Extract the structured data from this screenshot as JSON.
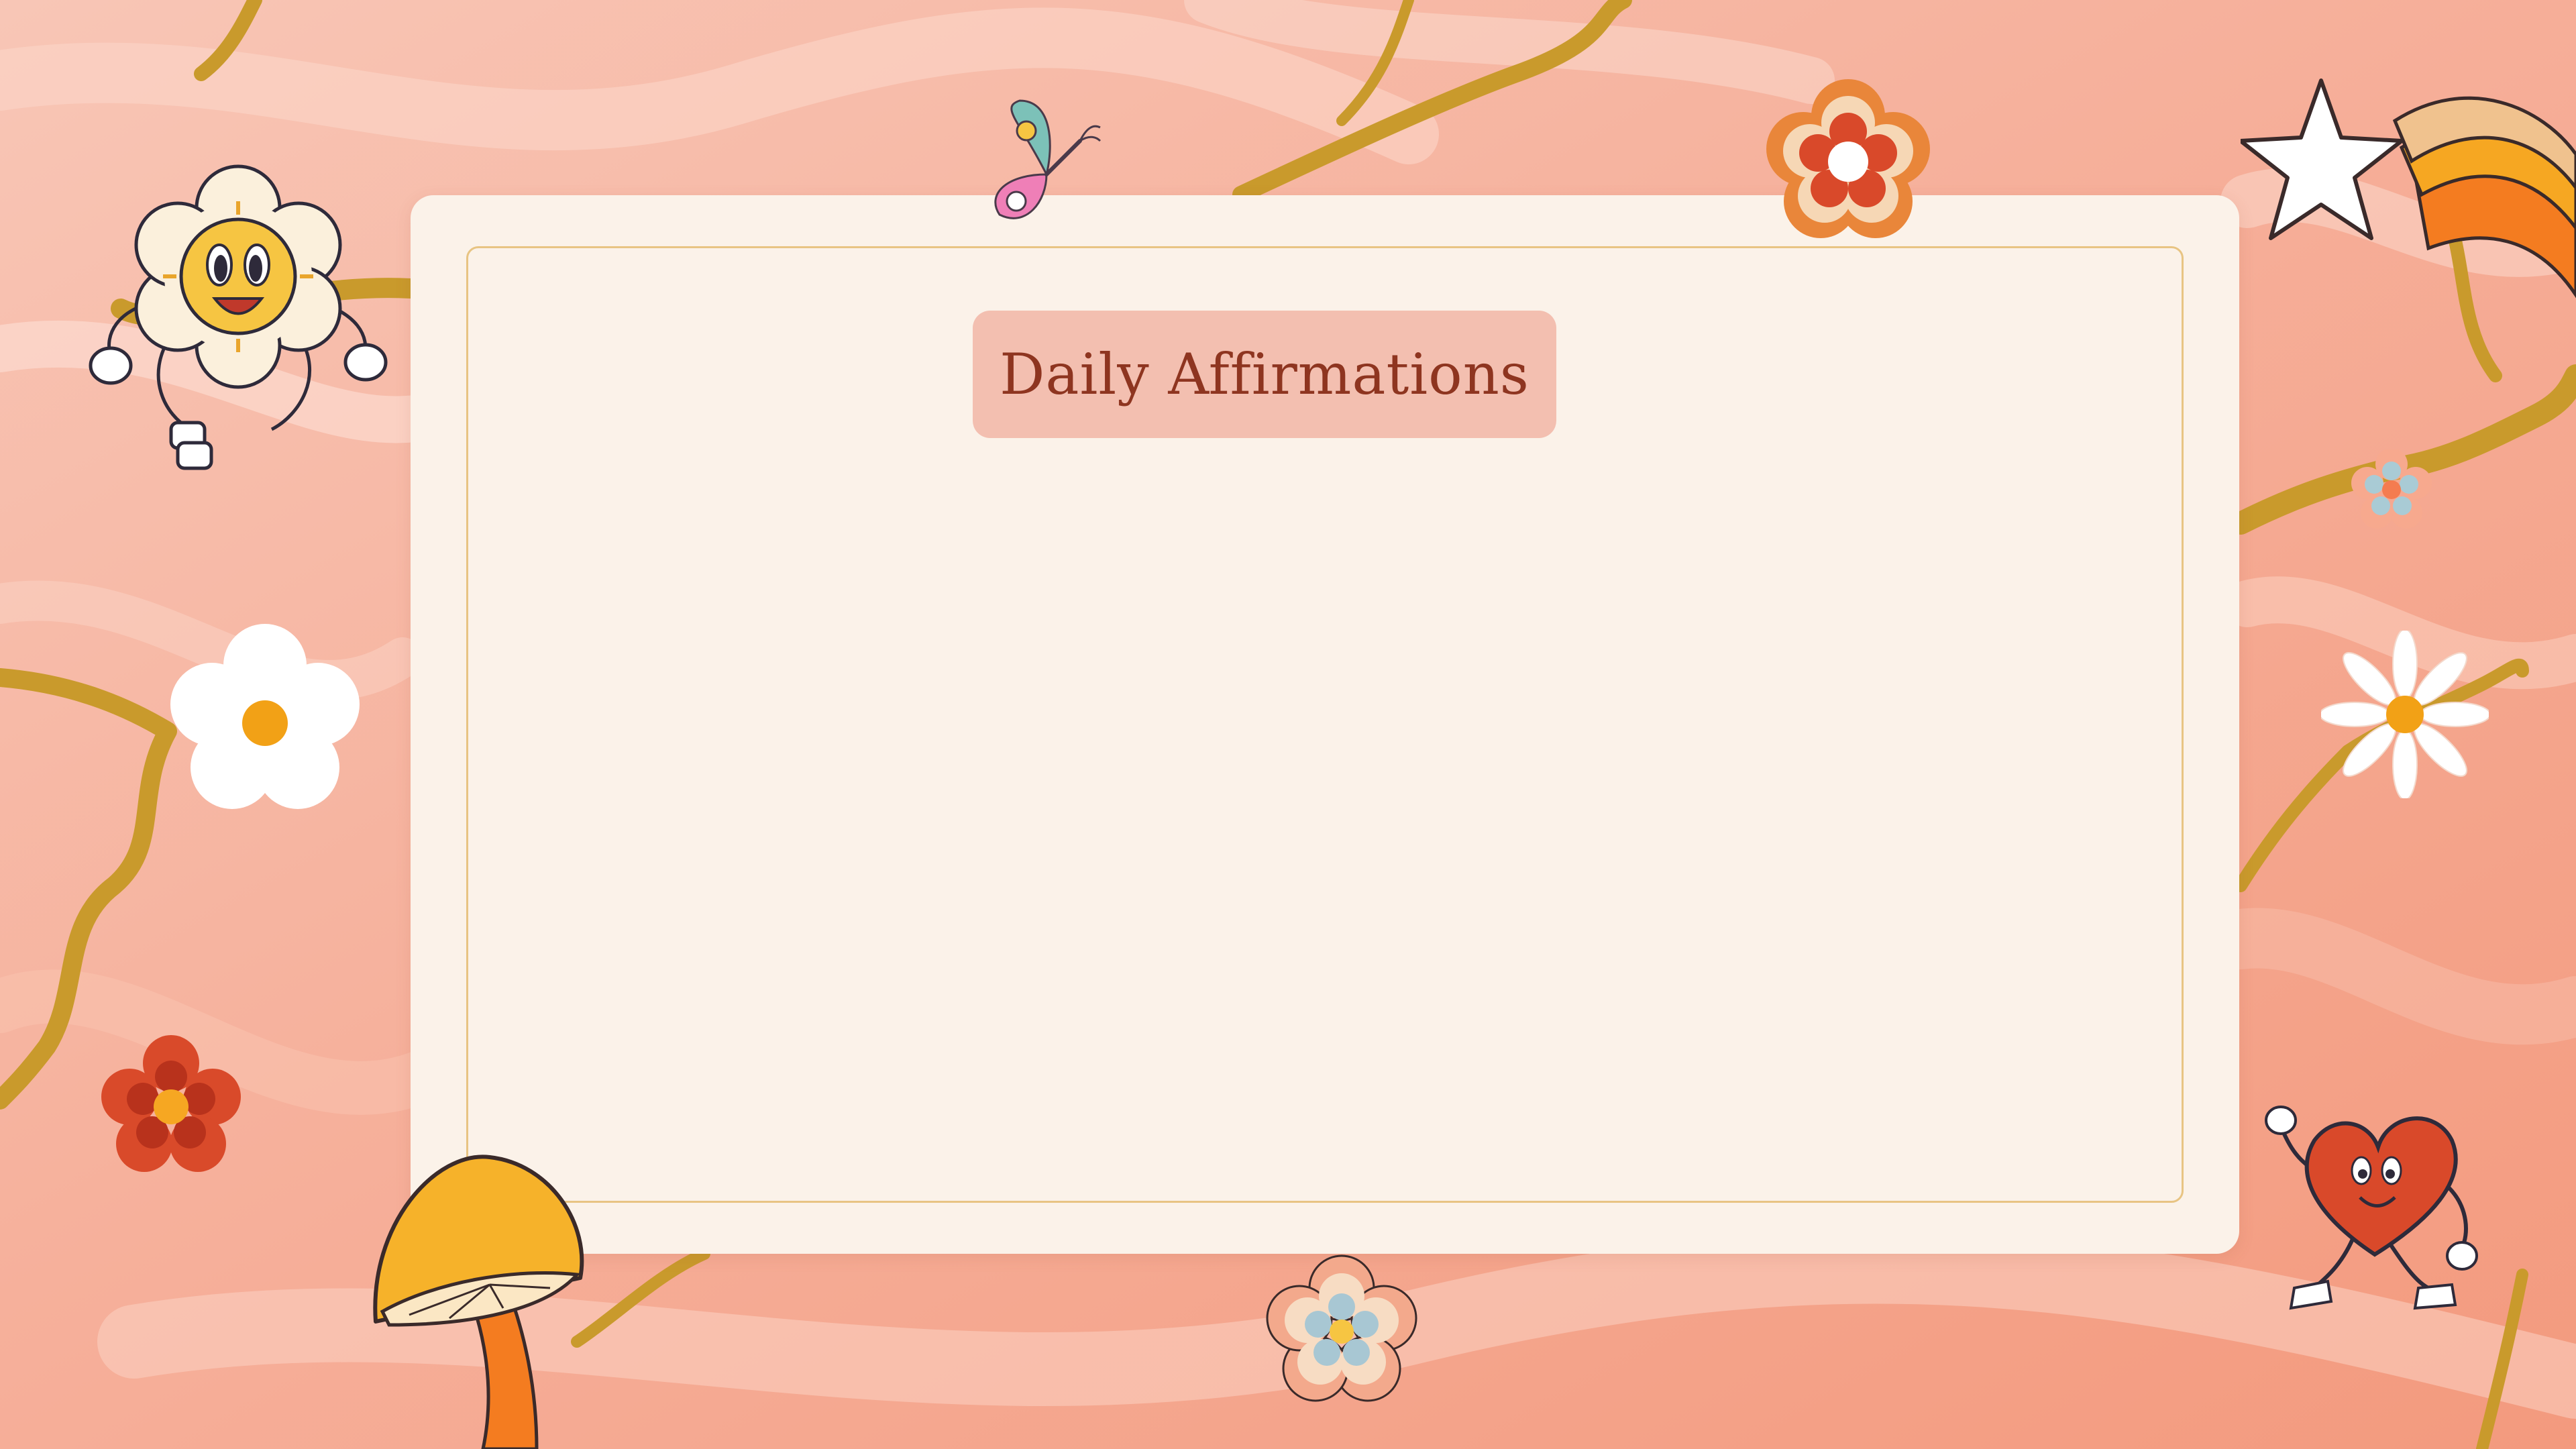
{
  "card": {
    "title": "Daily Affirmations"
  },
  "decorations": [
    {
      "name": "sun-flower-character-icon"
    },
    {
      "name": "butterfly-icon"
    },
    {
      "name": "orange-flower-icon"
    },
    {
      "name": "shooting-star-icon"
    },
    {
      "name": "small-retro-flower-icon"
    },
    {
      "name": "white-daisy-icon"
    },
    {
      "name": "white-flower-icon"
    },
    {
      "name": "red-flower-icon"
    },
    {
      "name": "mushroom-icon"
    },
    {
      "name": "blue-flower-icon"
    },
    {
      "name": "heart-character-icon"
    }
  ],
  "colors": {
    "background": "#f5b4a0",
    "card": "#fbf2e9",
    "card_border": "#e8c483",
    "title_pill": "#f3bfb0",
    "title_text": "#8e3520",
    "glitter": "#c99a2c"
  }
}
